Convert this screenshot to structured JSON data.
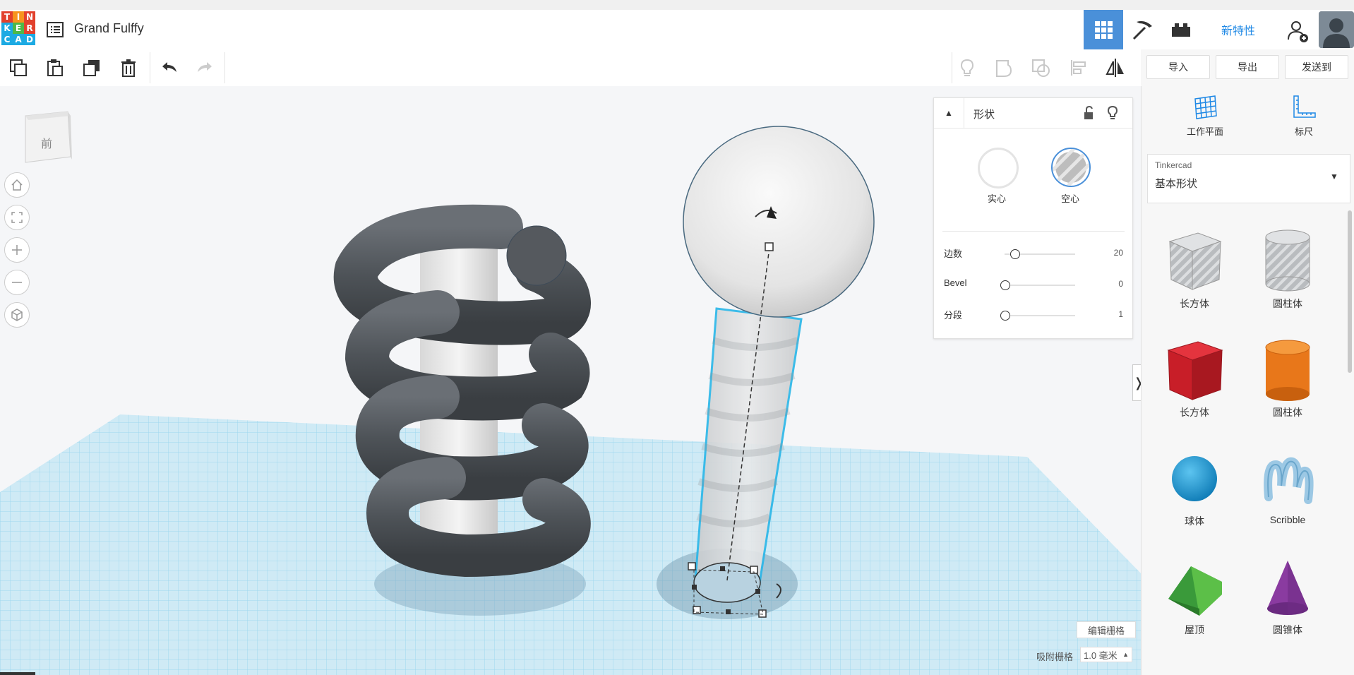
{
  "header": {
    "logo_letters": [
      "T",
      "I",
      "N",
      "K",
      "E",
      "R",
      "C",
      "A",
      "D"
    ],
    "design_name": "Grand Fulffy",
    "new_features": "新特性"
  },
  "right_toolbar": {
    "import_label": "导入",
    "export_label": "导出",
    "send_label": "发送到"
  },
  "viewcube": {
    "face_label": "前"
  },
  "shape_panel": {
    "title": "形状",
    "solid_label": "实心",
    "hole_label": "空心",
    "params": [
      {
        "label": "边数",
        "value": "20"
      },
      {
        "label": "Bevel",
        "value": "0"
      },
      {
        "label": "分段",
        "value": "1"
      }
    ]
  },
  "sidebar": {
    "workplane_label": "工作平面",
    "ruler_label": "标尺",
    "library_source": "Tinkercad",
    "library_name": "基本形状",
    "items": [
      {
        "label": "长方体",
        "icon": "box-hole-icon"
      },
      {
        "label": "圆柱体",
        "icon": "cylinder-hole-icon"
      },
      {
        "label": "长方体",
        "icon": "box-icon"
      },
      {
        "label": "圆柱体",
        "icon": "cylinder-icon"
      },
      {
        "label": "球体",
        "icon": "sphere-icon"
      },
      {
        "label": "Scribble",
        "icon": "scribble-icon"
      },
      {
        "label": "屋顶",
        "icon": "roof-icon"
      },
      {
        "label": "圆锥体",
        "icon": "cone-icon"
      }
    ]
  },
  "bottom": {
    "edit_grid_label": "编辑栅格",
    "snap_grid_label": "吸附栅格",
    "snap_grid_value": "1.0 毫米"
  },
  "colors": {
    "accent": "#4a90d9",
    "logo_red": "#e2412d",
    "logo_orange": "#f7941d",
    "logo_blue": "#1caae3",
    "logo_green": "#4db848",
    "box_red": "#d0202a",
    "cylinder_orange": "#e8771a",
    "sphere_blue": "#1a9ad6",
    "roof_green": "#3a9a3a",
    "cone_purple": "#8a3ba0"
  }
}
